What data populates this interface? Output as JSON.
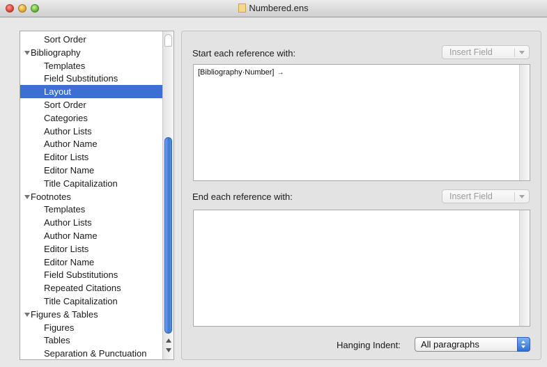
{
  "window": {
    "title": "Numbered.ens"
  },
  "sidebar": {
    "items": [
      {
        "label": "Sort Order",
        "level": 2
      },
      {
        "label": "Bibliography",
        "level": 1,
        "expanded": true
      },
      {
        "label": "Templates",
        "level": 2
      },
      {
        "label": "Field Substitutions",
        "level": 2
      },
      {
        "label": "Layout",
        "level": 2,
        "selected": true
      },
      {
        "label": "Sort Order",
        "level": 2
      },
      {
        "label": "Categories",
        "level": 2
      },
      {
        "label": "Author Lists",
        "level": 2
      },
      {
        "label": "Author Name",
        "level": 2
      },
      {
        "label": "Editor Lists",
        "level": 2
      },
      {
        "label": "Editor Name",
        "level": 2
      },
      {
        "label": "Title Capitalization",
        "level": 2
      },
      {
        "label": "Footnotes",
        "level": 1,
        "expanded": true
      },
      {
        "label": "Templates",
        "level": 2
      },
      {
        "label": "Author Lists",
        "level": 2
      },
      {
        "label": "Author Name",
        "level": 2
      },
      {
        "label": "Editor Lists",
        "level": 2
      },
      {
        "label": "Editor Name",
        "level": 2
      },
      {
        "label": "Field Substitutions",
        "level": 2
      },
      {
        "label": "Repeated Citations",
        "level": 2
      },
      {
        "label": "Title Capitalization",
        "level": 2
      },
      {
        "label": "Figures & Tables",
        "level": 1,
        "expanded": true
      },
      {
        "label": "Figures",
        "level": 2
      },
      {
        "label": "Tables",
        "level": 2
      },
      {
        "label": "Separation & Punctuation",
        "level": 2
      }
    ]
  },
  "panel": {
    "start_label": "Start each reference with:",
    "start_insert": "Insert Field",
    "start_content": "[Bibliography·Number]",
    "start_content_tab": "→",
    "end_label": "End each reference with:",
    "end_insert": "Insert Field",
    "end_content": "",
    "hanging_indent_label": "Hanging Indent:",
    "hanging_indent_value": "All paragraphs"
  },
  "colors": {
    "selection": "#3b6fd1",
    "scroll_thumb": "#3d79d6"
  }
}
